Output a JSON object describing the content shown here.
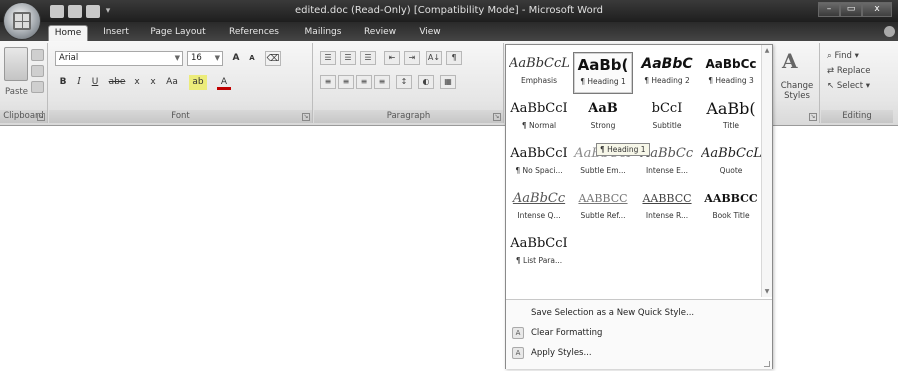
{
  "window": {
    "title": "edited.doc (Read-Only) [Compatibility Mode] - Microsoft Word",
    "controls": {
      "minimize": "–",
      "maximize": "▭",
      "close": "x"
    }
  },
  "tabs": [
    "Home",
    "Insert",
    "Page Layout",
    "References",
    "Mailings",
    "Review",
    "View"
  ],
  "groups": {
    "clipboard": {
      "label": "Clipboard",
      "paste": "Paste"
    },
    "font": {
      "label": "Font",
      "name": "Arial",
      "size": "16",
      "grow": "A",
      "shrink": "A",
      "bold": "B",
      "italic": "I",
      "underline": "U",
      "strike": "abe",
      "subscript": "x",
      "superscript": "x",
      "case": "Aa",
      "highlight": "ab",
      "color": "A"
    },
    "paragraph": {
      "label": "Paragraph",
      "show_marks": "¶",
      "sort": "A↓"
    },
    "styles": {
      "change_styles": "Change Styles"
    },
    "editing": {
      "label": "Editing",
      "find": "Find",
      "replace": "Replace",
      "select": "Select"
    }
  },
  "gallery": {
    "items": [
      {
        "preview": "AaBbCcL",
        "name": "Emphasis"
      },
      {
        "preview": "AaBb(",
        "name": "¶ Heading 1",
        "selected": true
      },
      {
        "preview": "AaBbC",
        "name": "¶ Heading 2"
      },
      {
        "preview": "AaBbCc",
        "name": "¶ Heading 3"
      },
      {
        "preview": "AaBbCcI",
        "name": "¶ Normal"
      },
      {
        "preview": "AaB",
        "name": "Strong"
      },
      {
        "preview": "bCcI",
        "name": "Subtitle"
      },
      {
        "preview": "AaBb(",
        "name": "Title"
      },
      {
        "preview": "AaBbCcI",
        "name": "¶ No Spaci..."
      },
      {
        "preview": "AaBbCcI",
        "name": "Subtle Em..."
      },
      {
        "preview": "AaBbCc",
        "name": "Intense E..."
      },
      {
        "preview": "AaBbCcL",
        "name": "Quote"
      },
      {
        "preview": "AaBbCc",
        "name": "Intense Q..."
      },
      {
        "preview": "AABBCC",
        "name": "Subtle Ref..."
      },
      {
        "preview": "AABBCC",
        "name": "Intense R..."
      },
      {
        "preview": "AABBCC",
        "name": "Book Title"
      },
      {
        "preview": "AaBbCcI",
        "name": "¶ List Para..."
      }
    ],
    "tooltip": "¶ Heading 1",
    "menu": {
      "save_selection": "Save Selection as a New Quick Style...",
      "clear_formatting": "Clear Formatting",
      "apply_styles": "Apply Styles..."
    }
  }
}
